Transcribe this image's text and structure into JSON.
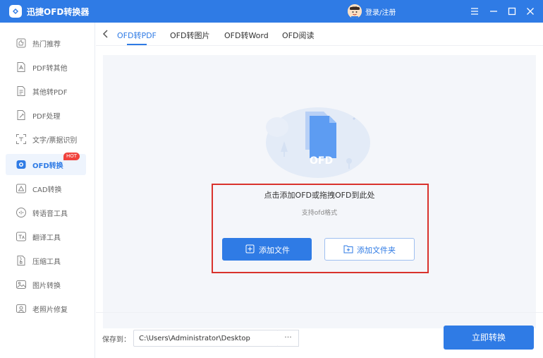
{
  "app": {
    "title": "迅捷OFD转换器",
    "login_label": "登录/注册",
    "accent_color": "#2f7be5"
  },
  "sidebar": {
    "items": [
      {
        "label": "热门推荐",
        "icon": "thumbs-up-icon"
      },
      {
        "label": "PDF转其他",
        "icon": "pdf-file-icon"
      },
      {
        "label": "其他转PDF",
        "icon": "file-to-pdf-icon"
      },
      {
        "label": "PDF处理",
        "icon": "pdf-edit-icon"
      },
      {
        "label": "文字/票据识别",
        "icon": "ocr-icon"
      },
      {
        "label": "OFD转换",
        "icon": "ofd-icon",
        "active": true,
        "badge": "HOT"
      },
      {
        "label": "CAD转换",
        "icon": "cad-icon"
      },
      {
        "label": "转语音工具",
        "icon": "speech-icon"
      },
      {
        "label": "翻译工具",
        "icon": "translate-icon"
      },
      {
        "label": "压缩工具",
        "icon": "compress-icon"
      },
      {
        "label": "图片转换",
        "icon": "image-icon"
      },
      {
        "label": "老照片修复",
        "icon": "photo-repair-icon"
      }
    ]
  },
  "tabs": [
    {
      "label": "OFD转PDF",
      "active": true
    },
    {
      "label": "OFD转图片"
    },
    {
      "label": "OFD转Word"
    },
    {
      "label": "OFD阅读"
    }
  ],
  "drop": {
    "illustration_text": "OFD",
    "title": "点击添加OFD或拖拽OFD到此处",
    "subtitle": "支持ofd格式",
    "add_file_label": "添加文件",
    "add_folder_label": "添加文件夹"
  },
  "footer": {
    "save_label": "保存到：",
    "path_value": "C:\\Users\\Administrator\\Desktop",
    "browse_label": "···",
    "convert_label": "立即转换"
  }
}
